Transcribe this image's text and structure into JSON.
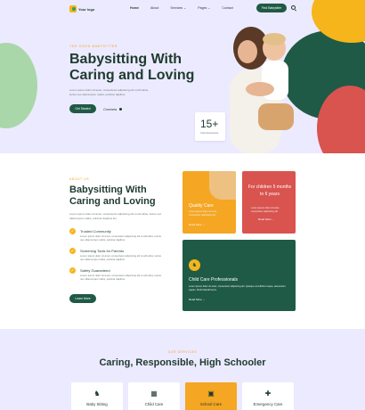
{
  "colors": {
    "brand_green": "#1f5a46",
    "accent_yellow": "#f5a623",
    "accent_red": "#d9534f",
    "hero_bg": "#eceaff"
  },
  "nav": {
    "logo": "Your logo",
    "items": [
      {
        "label": "Home",
        "active": true
      },
      {
        "label": "About"
      },
      {
        "label": "Services ⌄"
      },
      {
        "label": "Pages ⌄"
      },
      {
        "label": "Contact"
      }
    ],
    "cta": "Find Babysitter",
    "search_icon": "search-icon"
  },
  "hero": {
    "eyebrow": "THE GOOD BABYSITTER",
    "title": "Babysitting With Caring and Loving",
    "description": "Lorem ipsum dolor sit amet, consectetur adipiscing elit ut elit tellus, luctus nec ullamcorper mattis, pulvinar dapibus.",
    "cta": "Get Started",
    "signature": "Contaria",
    "stat_number": "15+",
    "stat_label": "Years Experience"
  },
  "about": {
    "eyebrow": "ABOUT US",
    "title": "Babysitting With Caring and Loving",
    "description": "Lorem ipsum dolor sit amet, consectetur adipiscing elit ut elit tellus, luctus nec ullamcorper mattis, pulvinar dapibus leo.",
    "features": [
      {
        "title": "Trusted Community",
        "desc": "Lorem ipsum dolor sit amet, consectetur adipiscing elit ut elit tellus, luctus nec ullamcorper mattis, pulvinar dapibus."
      },
      {
        "title": "Screening Tools for Parents",
        "desc": "Lorem ipsum dolor sit amet, consectetur adipiscing elit ut elit tellus, luctus nec ullamcorper mattis, pulvinar dapibus."
      },
      {
        "title": "Safety Guaranteed",
        "desc": "Lorem ipsum dolor sit amet, consectetur adipiscing elit ut elit tellus, luctus nec ullamcorper mattis, pulvinar dapibus."
      }
    ],
    "cta": "Learn More",
    "cards": {
      "quality": {
        "title": "Quality Care",
        "desc": "Lorem ipsum dolor sit amet, consectetur adipiscing elit.",
        "link": "Read More →"
      },
      "children": {
        "title": "For children 5 months to 6 years",
        "desc": "Lorem ipsum dolor sit amet, consectetur adipiscing elit.",
        "link": "Read More →"
      },
      "professionals": {
        "title": "Child Care Professionals",
        "desc": "Lorem ipsum dolor sit amet, consectetur adipiscing elit. Quisque vel efficitur neque, elementum sapien. Morbi blandit lorem.",
        "link": "Read More →"
      }
    }
  },
  "services": {
    "eyebrow": "OUR SERVICES",
    "title": "Caring, Responsible, High Schooler",
    "items": [
      {
        "label": "Baby Sitting",
        "icon": "stroller-icon"
      },
      {
        "label": "Child Care",
        "icon": "blocks-icon"
      },
      {
        "label": "School Care",
        "icon": "school-icon",
        "active": true
      },
      {
        "label": "Emergency Care",
        "icon": "hospital-icon"
      }
    ]
  }
}
